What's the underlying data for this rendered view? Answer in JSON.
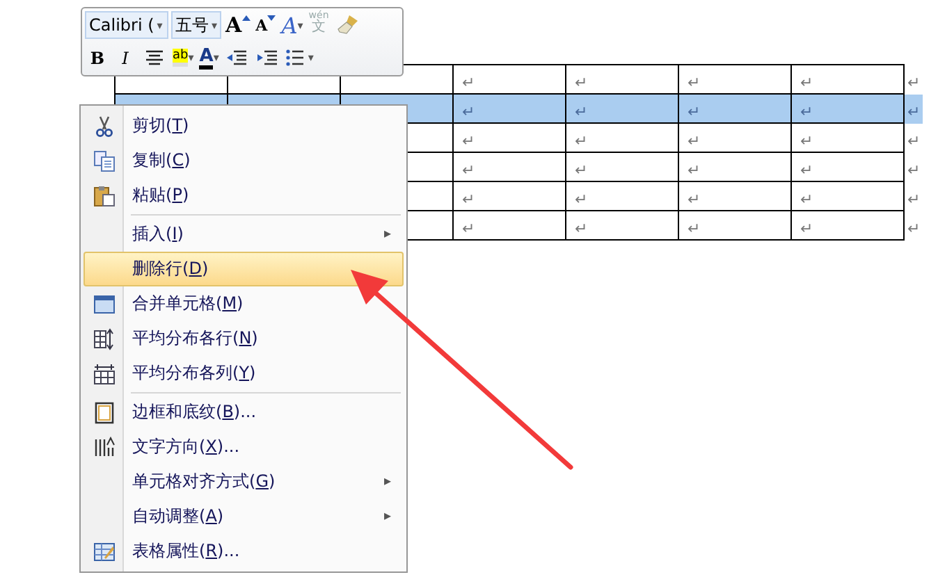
{
  "mini_toolbar": {
    "font": {
      "value": "Calibri (",
      "caret": "▾"
    },
    "size": {
      "value": "五号",
      "caret": "▾"
    },
    "row_1": [
      {
        "kind": "grow",
        "label": "A"
      },
      {
        "kind": "shrink",
        "label": "A"
      },
      {
        "kind": "styles",
        "label": "A",
        "caret": "▾"
      },
      {
        "kind": "phonetic",
        "label": "wén",
        "sub": "文"
      },
      {
        "kind": "brush"
      }
    ],
    "row_2": [
      {
        "kind": "bold",
        "label": "B"
      },
      {
        "kind": "italic",
        "label": "I"
      },
      {
        "kind": "center"
      },
      {
        "kind": "highlight",
        "label": "ab",
        "caret": "▾"
      },
      {
        "kind": "fontcolor",
        "label": "A",
        "caret": "▾"
      },
      {
        "kind": "outdent"
      },
      {
        "kind": "indent"
      },
      {
        "kind": "bullets",
        "caret": "▾"
      }
    ]
  },
  "table": {
    "rows": [
      {
        "selected": false,
        "cells": [
          "↵",
          "↵",
          "↵",
          "↵"
        ],
        "end_mark": "↵"
      },
      {
        "selected": true,
        "cells": [
          "↵",
          "↵",
          "↵",
          "↵"
        ],
        "end_mark": "↵"
      },
      {
        "selected": false,
        "cells": [
          "↵",
          "↵",
          "↵",
          "↵"
        ],
        "end_mark": "↵"
      },
      {
        "selected": false,
        "cells": [
          "↵",
          "↵",
          "↵",
          "↵"
        ],
        "end_mark": "↵"
      },
      {
        "selected": false,
        "cells": [
          "↵",
          "↵",
          "↵",
          "↵"
        ],
        "end_mark": "↵"
      },
      {
        "selected": false,
        "cells": [
          "↵",
          "↵",
          "↵",
          "↵"
        ],
        "end_mark": "↵"
      }
    ]
  },
  "context_menu": {
    "items": [
      {
        "kind": "cut",
        "text": "剪切(",
        "key": "T",
        "rest": ")",
        "selected": false
      },
      {
        "kind": "copy",
        "text": "复制(",
        "key": "C",
        "rest": ")",
        "selected": false
      },
      {
        "kind": "paste",
        "text": "粘贴(",
        "key": "P",
        "rest": ")",
        "selected": false
      },
      {
        "kind": "separator"
      },
      {
        "kind": "plain",
        "text": "插入(",
        "key": "I",
        "rest": ")",
        "submenu_arrow": "▸",
        "selected": false
      },
      {
        "kind": "plain",
        "text": "删除行(",
        "key": "D",
        "rest": ")",
        "selected": true
      },
      {
        "kind": "merge",
        "text": "合并单元格(",
        "key": "M",
        "rest": ")",
        "selected": false
      },
      {
        "kind": "rows",
        "text": "平均分布各行(",
        "key": "N",
        "rest": ")",
        "selected": false
      },
      {
        "kind": "cols",
        "text": "平均分布各列(",
        "key": "Y",
        "rest": ")",
        "selected": false
      },
      {
        "kind": "separator"
      },
      {
        "kind": "border",
        "text": "边框和底纹(",
        "key": "B",
        "rest": ")...",
        "selected": false
      },
      {
        "kind": "direction",
        "text": "文字方向(",
        "key": "X",
        "rest": ")...",
        "selected": false
      },
      {
        "kind": "plain",
        "text": "单元格对齐方式(",
        "key": "G",
        "rest": ")",
        "submenu_arrow": "▸",
        "selected": false
      },
      {
        "kind": "plain",
        "text": "自动调整(",
        "key": "A",
        "rest": ")",
        "submenu_arrow": "▸",
        "selected": false
      },
      {
        "kind": "properties",
        "text": "表格属性(",
        "key": "R",
        "rest": ")...",
        "selected": false
      }
    ]
  }
}
